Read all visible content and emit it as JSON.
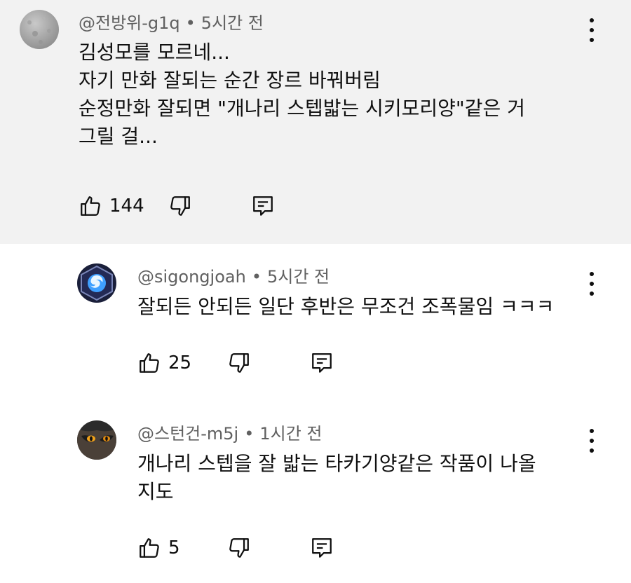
{
  "comments": [
    {
      "author": "@전방위-g1q",
      "separator": "•",
      "time": "5시간 전",
      "lines": [
        "김성모를 모르네...",
        "자기 만화 잘되는 순간 장르 바꿔버림",
        "순정만화 잘되면 \"개나리 스텝밟는 시키모리양\"같은 거",
        "그릴 걸..."
      ],
      "likes": "144",
      "avatar_icon": "gray-stone-avatar"
    },
    {
      "author": "@sigongjoah",
      "separator": "•",
      "time": "5시간 전",
      "lines": [
        "잘되든 안되든 일단 후반은 무조건 조폭물임 ㅋㅋㅋ"
      ],
      "likes": "25",
      "avatar_icon": "blue-swirl-hexagon-avatar"
    },
    {
      "author": "@스턴건-m5j",
      "separator": "•",
      "time": "1시간 전",
      "lines": [
        "개나리 스텝을 잘 밟는 타카기양같은 작품이 나올",
        "지도"
      ],
      "likes": "5",
      "avatar_icon": "wolf-eye-avatar"
    }
  ],
  "colors": {
    "highlight_bg": "#f2f2f2",
    "meta_text": "#606060",
    "text": "#0f0f0f"
  }
}
